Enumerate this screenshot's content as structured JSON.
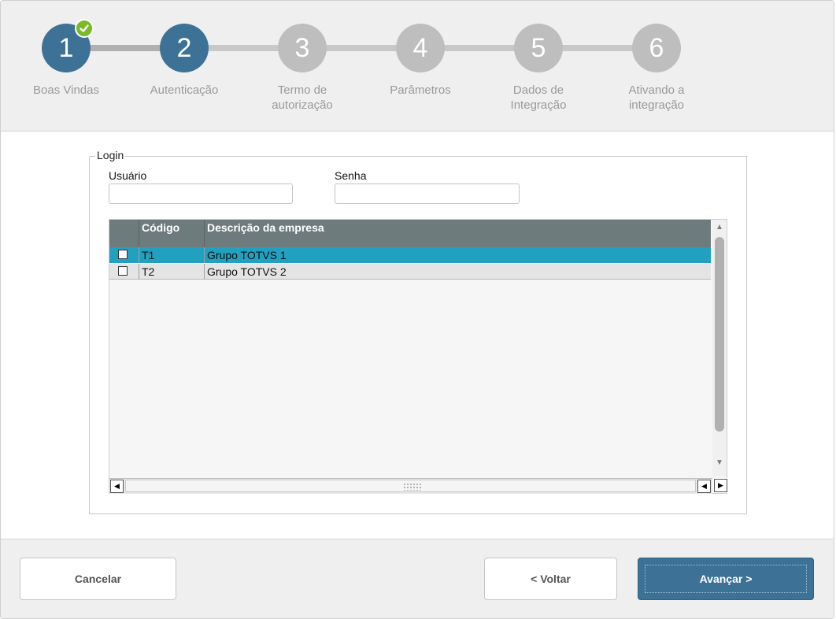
{
  "wizard": {
    "steps": [
      {
        "number": "1",
        "label_line1": "Boas Vindas",
        "label_line2": "",
        "state": "done"
      },
      {
        "number": "2",
        "label_line1": "Autenticação",
        "label_line2": "",
        "state": "current"
      },
      {
        "number": "3",
        "label_line1": "Termo de",
        "label_line2": "autorização",
        "state": "pending"
      },
      {
        "number": "4",
        "label_line1": "Parâmetros",
        "label_line2": "",
        "state": "pending"
      },
      {
        "number": "5",
        "label_line1": "Dados de",
        "label_line2": "Integração",
        "state": "pending"
      },
      {
        "number": "6",
        "label_line1": "Ativando a",
        "label_line2": "integração",
        "state": "pending"
      }
    ]
  },
  "login": {
    "legend": "Login",
    "user_label": "Usuário",
    "user_value": "",
    "password_label": "Senha",
    "password_value": ""
  },
  "grid": {
    "columns": [
      "",
      "Código",
      "Descrição da empresa"
    ],
    "rows": [
      {
        "checked": false,
        "code": "T1",
        "description": "Grupo TOTVS 1",
        "selected": true
      },
      {
        "checked": false,
        "code": "T2",
        "description": "Grupo TOTVS 2",
        "selected": false
      }
    ],
    "scroll_up_icon": "arrow-up-icon",
    "scroll_down_icon": "arrow-down-icon",
    "scroll_left_icon": "arrow-left-icon",
    "scroll_right_icon": "arrow-right-icon"
  },
  "footer": {
    "cancel_label": "Cancelar",
    "back_label": "< Voltar",
    "next_label": "Avançar >"
  },
  "colors": {
    "active_step": "#3d7296",
    "inactive_step": "#bebebe",
    "done_check": "#7ab929",
    "selected_row": "#22a0c0",
    "grid_header": "#6e7b7d"
  }
}
